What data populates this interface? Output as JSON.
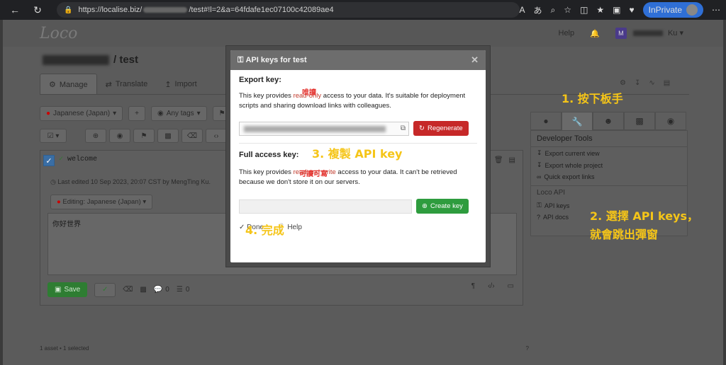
{
  "browser": {
    "url_prefix": "https://localise.biz/",
    "url_suffix": "/test#!l=2&a=64fdafe1ec07100c42089ae4",
    "inprivate_label": "InPrivate"
  },
  "app": {
    "logo": "Loco",
    "help": "Help",
    "user_initial": "M",
    "user_suffix": "Ku"
  },
  "project": {
    "title": "/ test"
  },
  "tabs": [
    {
      "label": "Manage"
    },
    {
      "label": "Translate"
    },
    {
      "label": "Import"
    }
  ],
  "filters": {
    "locale": "Japanese (Japan)",
    "tags": "Any tags"
  },
  "asset": {
    "key": "welcome",
    "last_edited": "Last edited 10 Sep 2023, 20:07 CST by MengTing Ku.",
    "editing": "Editing: Japanese (Japan)",
    "text": "你好世界",
    "save": "Save",
    "comments": "0",
    "stack": "0"
  },
  "footer": {
    "count": "1 asset • 1 selected"
  },
  "right_panel": {
    "title": "Developer Tools",
    "links": [
      {
        "label": "Export current view"
      },
      {
        "label": "Export whole project"
      },
      {
        "label": "Quick export links"
      }
    ],
    "section": "Loco API",
    "api_links": [
      {
        "label": "API keys"
      },
      {
        "label": "API docs"
      }
    ]
  },
  "modal": {
    "title": "API keys for test",
    "export_label": "Export key:",
    "export_text_a": "This key provides ",
    "export_text_ro": "read-only",
    "export_text_b": " access to your data. It's suitable for deployment scripts and sharing download links with colleagues.",
    "regenerate": "Regenerate",
    "full_label": "Full access key:",
    "full_text_a": "This key provides ",
    "full_text_rw": "read and write",
    "full_text_b": " access to your data. It can't be retrieved because we don't store it on our servers.",
    "create": "Create key",
    "done": "Done",
    "help": "Help"
  },
  "annotations": {
    "step1": "1. 按下板手",
    "step2_line1": "2. 選擇 API keys，",
    "step2_line2": "就會跳出彈窗",
    "step3": "3. 複製 API key",
    "step4": "4. 完成",
    "readonly_note": "唯讀",
    "readwrite_note": "可讀可寫"
  }
}
